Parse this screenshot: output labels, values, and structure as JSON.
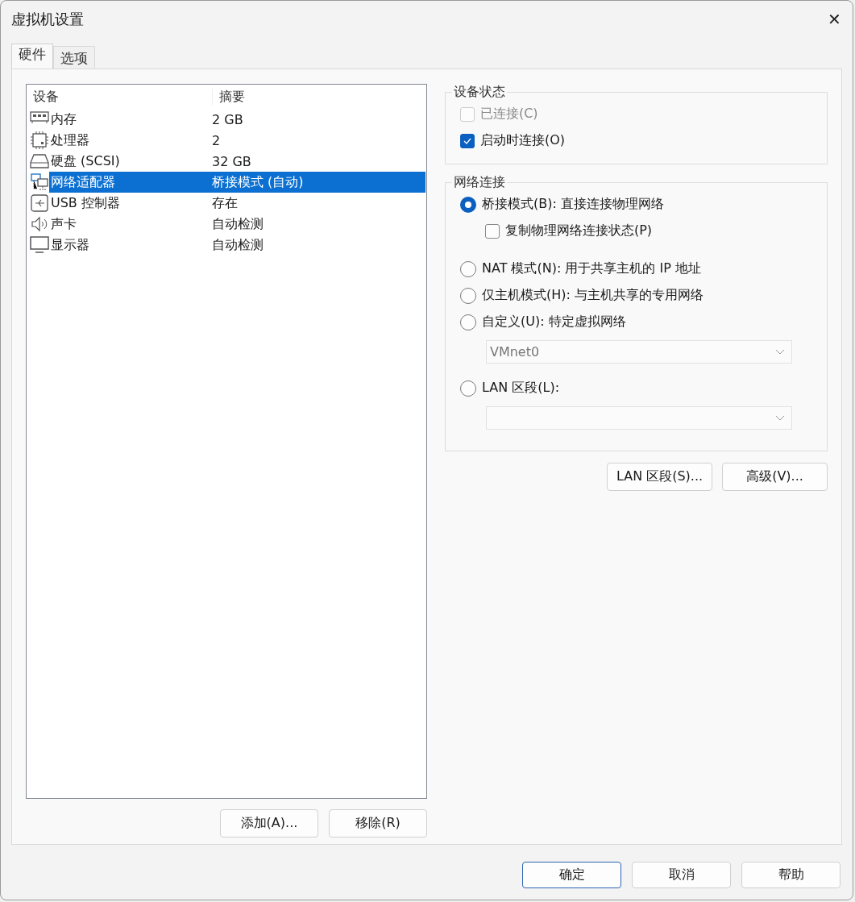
{
  "window": {
    "title": "虚拟机设置",
    "close": "✕"
  },
  "tabs": [
    {
      "label": "硬件",
      "selected": true
    },
    {
      "label": "选项",
      "selected": false
    }
  ],
  "device_table": {
    "columns": [
      "设备",
      "摘要"
    ],
    "rows": [
      {
        "kind": "memory",
        "device": "内存",
        "summary": "2 GB",
        "selected": false
      },
      {
        "kind": "cpu",
        "device": "处理器",
        "summary": "2",
        "selected": false
      },
      {
        "kind": "disk",
        "device": "硬盘 (SCSI)",
        "summary": "32 GB",
        "selected": false
      },
      {
        "kind": "network",
        "device": "网络适配器",
        "summary": "桥接模式 (自动)",
        "selected": true
      },
      {
        "kind": "usb",
        "device": "USB 控制器",
        "summary": "存在",
        "selected": false
      },
      {
        "kind": "sound",
        "device": "声卡",
        "summary": "自动检测",
        "selected": false
      },
      {
        "kind": "display",
        "device": "显示器",
        "summary": "自动检测",
        "selected": false
      }
    ]
  },
  "list_buttons": [
    "添加(A)...",
    "移除(R)"
  ],
  "device_status": {
    "title": "设备状态",
    "options": [
      {
        "label": "已连接(C)",
        "checked": false,
        "disabled": true
      },
      {
        "label": "启动时连接(O)",
        "checked": true,
        "disabled": false
      }
    ]
  },
  "network_connection": {
    "title": "网络连接",
    "items": [
      {
        "kind": "radio",
        "label": "桥接模式(B): 直接连接物理网络",
        "selected": true
      },
      {
        "kind": "checkbox",
        "label": "复制物理网络连接状态(P)",
        "checked": false
      },
      {
        "kind": "radio",
        "label": "NAT 模式(N): 用于共享主机的 IP 地址",
        "selected": false
      },
      {
        "kind": "radio",
        "label": "仅主机模式(H): 与主机共享的专用网络",
        "selected": false
      },
      {
        "kind": "radio",
        "label": "自定义(U): 特定虚拟网络",
        "selected": false
      },
      {
        "kind": "dropdown",
        "value": "VMnet0",
        "disabled": true
      },
      {
        "kind": "radio",
        "label": "LAN 区段(L):",
        "selected": false
      },
      {
        "kind": "dropdown",
        "disabled": true
      }
    ]
  },
  "network_buttons": [
    "LAN 区段(S)...",
    "高级(V)..."
  ],
  "dialog_buttons": [
    {
      "label": "确定",
      "default": true
    },
    {
      "label": "取消",
      "default": false
    },
    {
      "label": "帮助",
      "default": false
    }
  ]
}
